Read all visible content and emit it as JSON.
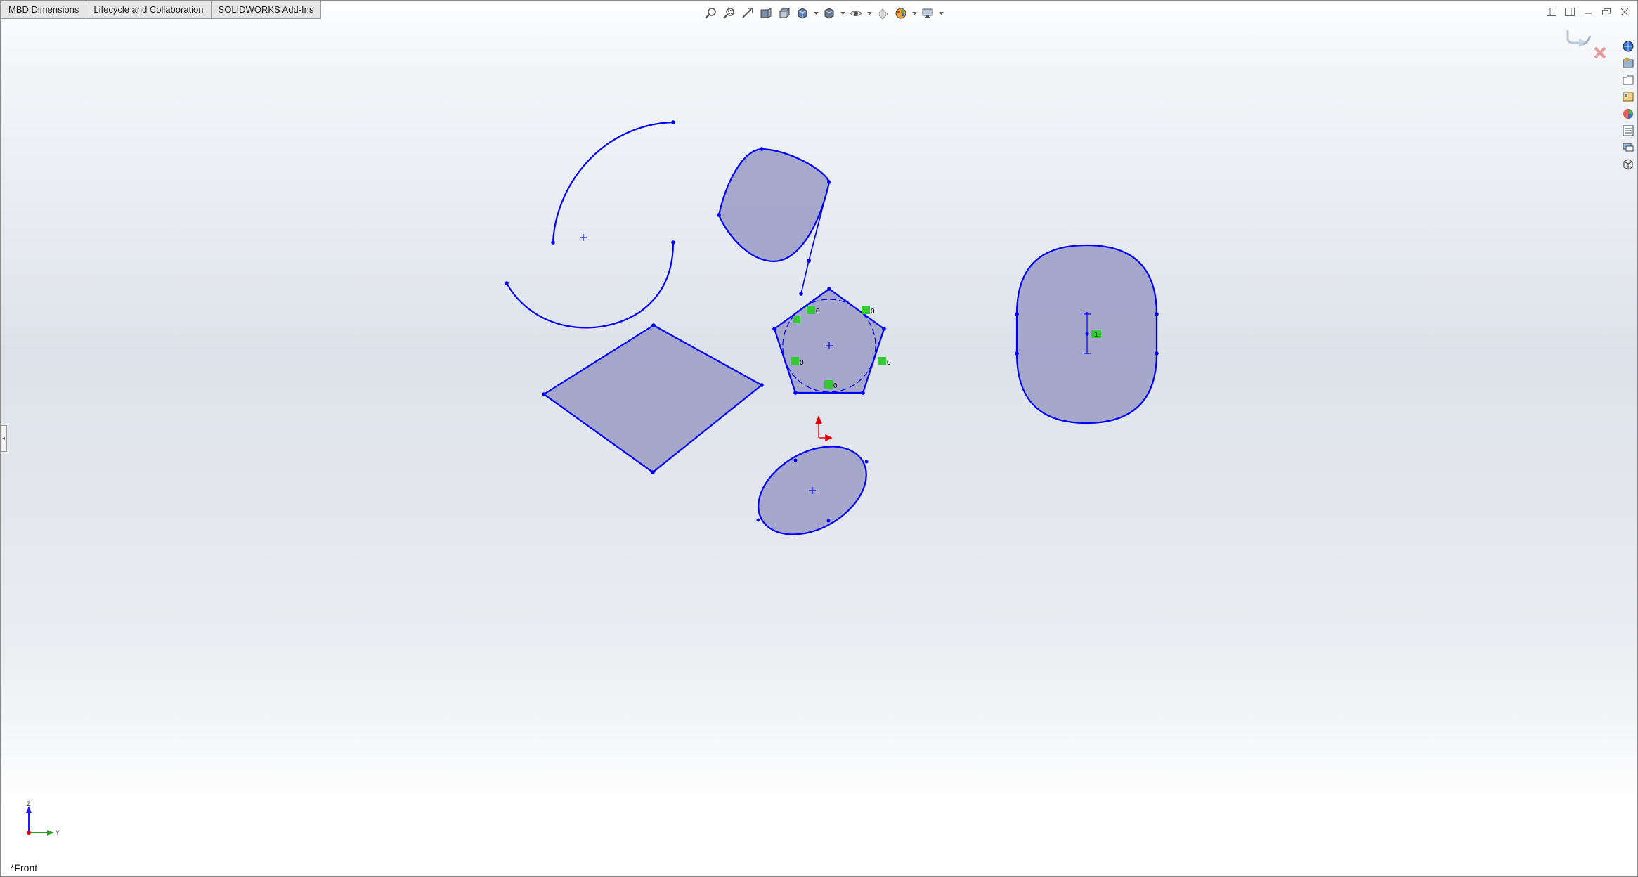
{
  "tabs": [
    "MBD Dimensions",
    "Lifecycle and Collaboration",
    "SOLIDWORKS Add-Ins"
  ],
  "hud_icons": [
    "zoom-to-fit-icon",
    "zoom-to-area-icon",
    "previous-view-icon",
    "section-view-icon",
    "dynamic-annotation-icon",
    "view-orientation-icon",
    "display-style-icon",
    "hide-show-items-icon",
    "edit-appearance-icon",
    "apply-scene-icon",
    "view-settings-icon"
  ],
  "taskpane_icons": [
    "solidworks-resources-icon",
    "design-library-icon",
    "file-explorer-icon",
    "view-palette-icon",
    "appearances-scenes-icon",
    "custom-properties-icon",
    "forum-icon",
    "3d-content-icon"
  ],
  "sketch_relations": [
    "0",
    "0",
    "0",
    "0",
    "0"
  ],
  "slot_relation": "1",
  "view_name": "*Front",
  "triad": {
    "vertical_axis": "Z",
    "horizontal_axis": "Y"
  },
  "colors": {
    "sketch_line": "#0000ff",
    "region_fill": "#9ea0c8",
    "relation_badge": "#35c935",
    "origin": "#e00000"
  }
}
